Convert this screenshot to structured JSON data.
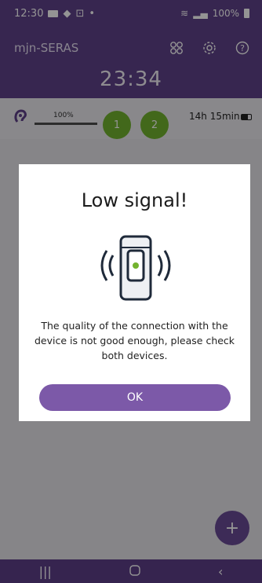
{
  "statusbar": {
    "time": "12:30",
    "battery": "100%"
  },
  "app": {
    "title": "mjn-SERAS",
    "timer": "23:34"
  },
  "device": {
    "signal_percent_label": "100%",
    "channel_1": "1",
    "channel_2": "2",
    "battery_time": "14h 15min"
  },
  "dialog": {
    "title": "Low signal!",
    "message": "The quality of the connection with the device is not good enough, please check both devices.",
    "ok_label": "OK"
  },
  "fab": {
    "label": "+"
  },
  "colors": {
    "primary": "#60428a",
    "button": "#7c59a8",
    "channel": "#73b32f"
  }
}
